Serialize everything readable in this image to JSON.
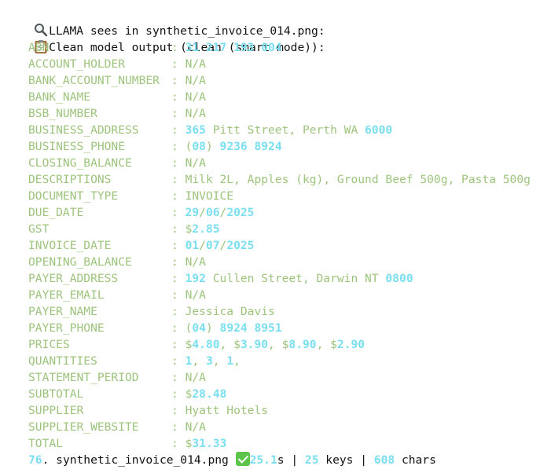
{
  "header": {
    "line1_icon": "magnifier-icon",
    "line1_text": "LLAMA sees in synthetic_invoice_014.png:",
    "line2_icon": "clipboard-icon",
    "line2_text": "Clean model output (clean (smart mode)):"
  },
  "colors": {
    "key": "#9dc47c",
    "number": "#79dff0",
    "check": "#5cc44a"
  },
  "fields": [
    {
      "key": "ABN",
      "value": [
        [
          "n",
          "31 217 193 004"
        ]
      ]
    },
    {
      "key": "ACCOUNT_HOLDER",
      "value": [
        [
          "v",
          "N/A"
        ]
      ]
    },
    {
      "key": "BANK_ACCOUNT_NUMBER",
      "value": [
        [
          "v",
          "N/A"
        ]
      ]
    },
    {
      "key": "BANK_NAME",
      "value": [
        [
          "v",
          "N/A"
        ]
      ]
    },
    {
      "key": "BSB_NUMBER",
      "value": [
        [
          "v",
          "N/A"
        ]
      ]
    },
    {
      "key": "BUSINESS_ADDRESS",
      "value": [
        [
          "n",
          "365"
        ],
        [
          "v",
          " Pitt Street, Perth WA "
        ],
        [
          "n",
          "6000"
        ]
      ]
    },
    {
      "key": "BUSINESS_PHONE",
      "value": [
        [
          "p",
          "("
        ],
        [
          "n",
          "08"
        ],
        [
          "p",
          ")"
        ],
        [
          "n",
          " 9236 8924"
        ]
      ]
    },
    {
      "key": "CLOSING_BALANCE",
      "value": [
        [
          "v",
          "N/A"
        ]
      ]
    },
    {
      "key": "DESCRIPTIONS",
      "value": [
        [
          "v",
          "Milk 2L, Apples "
        ],
        [
          "p",
          "(kg)"
        ],
        [
          "v",
          ", Ground Beef 500g, Pasta 500g"
        ]
      ]
    },
    {
      "key": "DOCUMENT_TYPE",
      "value": [
        [
          "v",
          "INVOICE"
        ]
      ]
    },
    {
      "key": "DUE_DATE",
      "value": [
        [
          "n",
          "29"
        ],
        [
          "v",
          "/"
        ],
        [
          "n",
          "06"
        ],
        [
          "v",
          "/"
        ],
        [
          "n",
          "2025"
        ]
      ]
    },
    {
      "key": "GST",
      "value": [
        [
          "v",
          "$"
        ],
        [
          "n",
          "2.85"
        ]
      ]
    },
    {
      "key": "INVOICE_DATE",
      "value": [
        [
          "n",
          "01"
        ],
        [
          "v",
          "/"
        ],
        [
          "n",
          "07"
        ],
        [
          "v",
          "/"
        ],
        [
          "n",
          "2025"
        ]
      ]
    },
    {
      "key": "OPENING_BALANCE",
      "value": [
        [
          "v",
          "N/A"
        ]
      ]
    },
    {
      "key": "PAYER_ADDRESS",
      "value": [
        [
          "n",
          "192"
        ],
        [
          "v",
          " Cullen Street, Darwin NT "
        ],
        [
          "n",
          "0800"
        ]
      ]
    },
    {
      "key": "PAYER_EMAIL",
      "value": [
        [
          "v",
          "N/A"
        ]
      ]
    },
    {
      "key": "PAYER_NAME",
      "value": [
        [
          "v",
          "Jessica Davis"
        ]
      ]
    },
    {
      "key": "PAYER_PHONE",
      "value": [
        [
          "p",
          "("
        ],
        [
          "n",
          "04"
        ],
        [
          "p",
          ")"
        ],
        [
          "n",
          " 8924 8951"
        ]
      ]
    },
    {
      "key": "PRICES",
      "value": [
        [
          "v",
          "$"
        ],
        [
          "n",
          "4.80"
        ],
        [
          "v",
          ", $"
        ],
        [
          "n",
          "3.90"
        ],
        [
          "v",
          ", $"
        ],
        [
          "n",
          "8.90"
        ],
        [
          "v",
          ", $"
        ],
        [
          "n",
          "2.90"
        ]
      ]
    },
    {
      "key": "QUANTITIES",
      "value": [
        [
          "n",
          "1"
        ],
        [
          "v",
          ", "
        ],
        [
          "n",
          "3"
        ],
        [
          "v",
          ", "
        ],
        [
          "n",
          "1"
        ],
        [
          "v",
          ","
        ]
      ]
    },
    {
      "key": "STATEMENT_PERIOD",
      "value": [
        [
          "v",
          "N/A"
        ]
      ]
    },
    {
      "key": "SUBTOTAL",
      "value": [
        [
          "v",
          "$"
        ],
        [
          "n",
          "28.48"
        ]
      ]
    },
    {
      "key": "SUPPLIER",
      "value": [
        [
          "v",
          "Hyatt Hotels"
        ]
      ]
    },
    {
      "key": "SUPPLIER_WEBSITE",
      "value": [
        [
          "v",
          "N/A"
        ]
      ]
    },
    {
      "key": "TOTAL",
      "value": [
        [
          "v",
          "$"
        ],
        [
          "n",
          "31.33"
        ]
      ]
    }
  ],
  "separator": ": ",
  "footer": {
    "index": "76",
    "dot": ". ",
    "filename": "synthetic_invoice_014.png ",
    "check_icon": "check-mark-icon",
    "time_num": "25.1",
    "time_unit": "s | ",
    "keys_num": "25",
    "keys_label": " keys | ",
    "chars_num": "608",
    "chars_label": " chars"
  }
}
